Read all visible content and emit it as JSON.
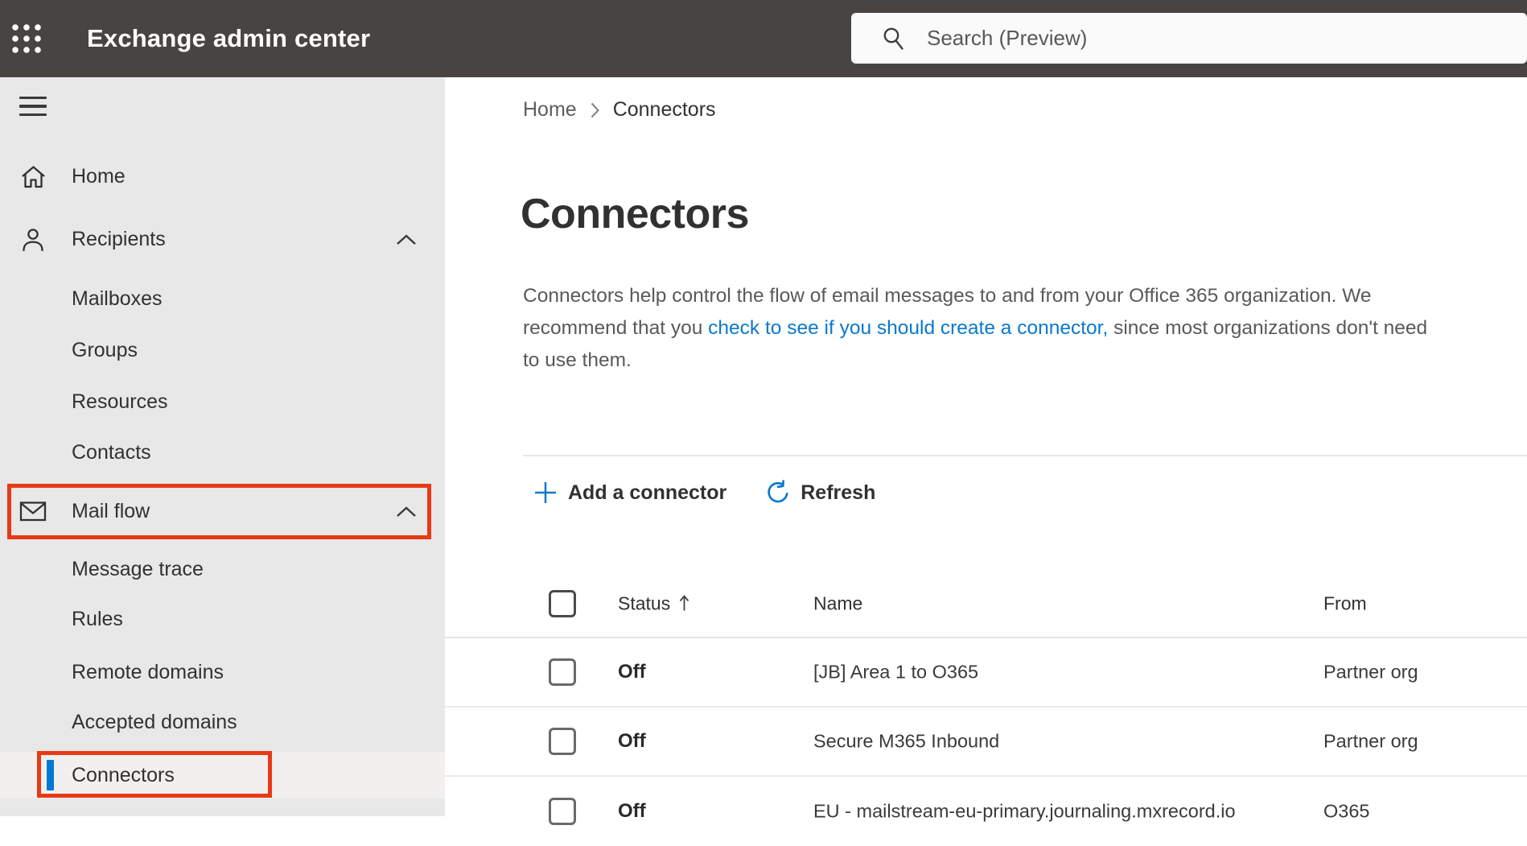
{
  "topbar": {
    "title": "Exchange admin center",
    "search_placeholder": "Search (Preview)"
  },
  "sidebar": {
    "items": [
      {
        "label": "Home"
      },
      {
        "label": "Recipients"
      },
      {
        "label": "Mailboxes"
      },
      {
        "label": "Groups"
      },
      {
        "label": "Resources"
      },
      {
        "label": "Contacts"
      },
      {
        "label": "Mail flow"
      },
      {
        "label": "Message trace"
      },
      {
        "label": "Rules"
      },
      {
        "label": "Remote domains"
      },
      {
        "label": "Accepted domains"
      },
      {
        "label": "Connectors"
      }
    ]
  },
  "breadcrumb": {
    "home": "Home",
    "current": "Connectors"
  },
  "page": {
    "title": "Connectors",
    "description": {
      "before": "Connectors help control the flow of email messages to and from your Office 365 organization. We recommend that you ",
      "link": "check to see if you should create a connector,",
      "after": " since most organizations don't need to use them."
    }
  },
  "toolbar": {
    "add_label": "Add a connector",
    "refresh_label": "Refresh"
  },
  "table": {
    "columns": {
      "status": "Status",
      "name": "Name",
      "from": "From"
    },
    "sort": {
      "column": "Status",
      "direction": "ascending"
    },
    "rows": [
      {
        "status": "Off",
        "name": "[JB] Area 1 to O365",
        "from": "Partner org"
      },
      {
        "status": "Off",
        "name": "Secure M365 Inbound",
        "from": "Partner org"
      },
      {
        "status": "Off",
        "name": "EU - mailstream-eu-primary.journaling.mxrecord.io",
        "from": "O365"
      }
    ]
  },
  "colors": {
    "accent": "#0078d4",
    "annotation_red": "#e83a15",
    "topbar_bg": "#474442",
    "sidebar_bg": "#e9e8e8"
  }
}
